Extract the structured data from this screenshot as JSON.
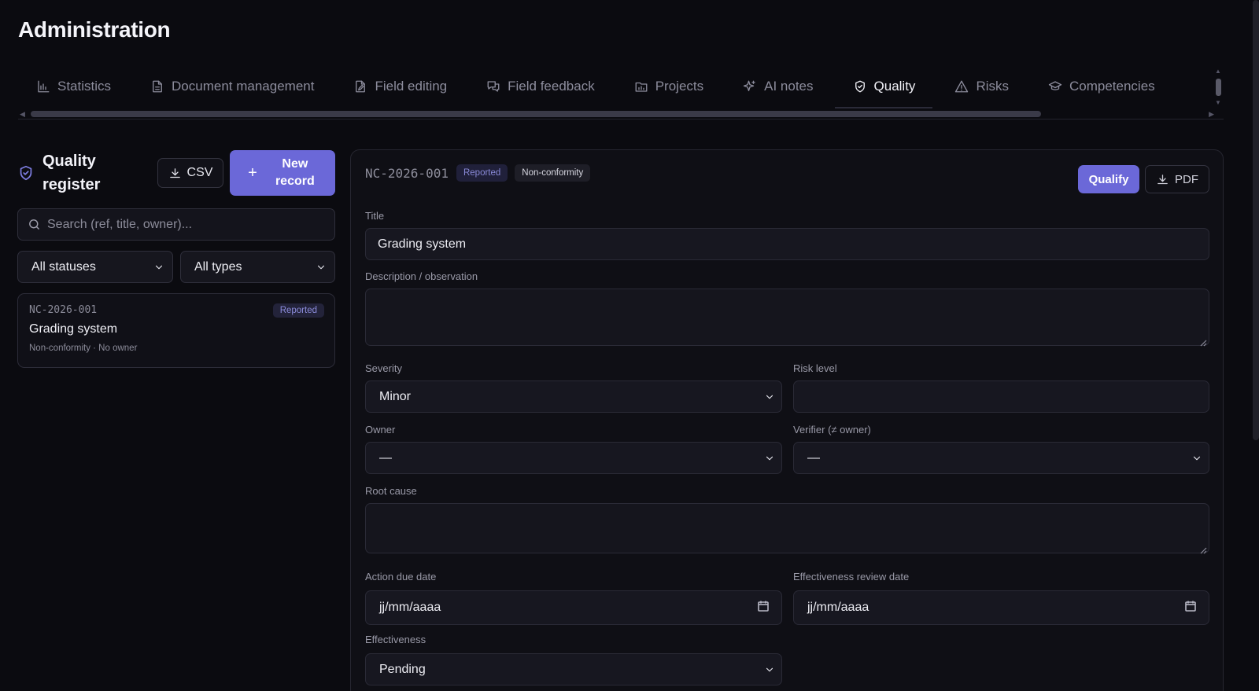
{
  "page": {
    "title": "Administration"
  },
  "tabs": [
    {
      "label": "Statistics",
      "icon": "bar-chart-icon"
    },
    {
      "label": "Document management",
      "icon": "document-icon"
    },
    {
      "label": "Field editing",
      "icon": "file-edit-icon"
    },
    {
      "label": "Field feedback",
      "icon": "chat-icon"
    },
    {
      "label": "Projects",
      "icon": "folder-chart-icon"
    },
    {
      "label": "AI notes",
      "icon": "sparkles-icon"
    },
    {
      "label": "Quality",
      "icon": "shield-check-icon",
      "active": true
    },
    {
      "label": "Risks",
      "icon": "warning-icon"
    },
    {
      "label": "Competencies",
      "icon": "graduation-cap-icon"
    }
  ],
  "register": {
    "title": "Quality register",
    "csv_label": "CSV",
    "new_label": "New record",
    "search_placeholder": "Search (ref, title, owner)...",
    "status_filter": "All statuses",
    "type_filter": "All types",
    "items": [
      {
        "ref": "NC-2026-001",
        "status": "Reported",
        "title": "Grading system",
        "meta": "Non-conformity  · No owner"
      }
    ]
  },
  "detail": {
    "ref": "NC-2026-001",
    "status": "Reported",
    "type": "Non-conformity",
    "qualify_label": "Qualify",
    "pdf_label": "PDF",
    "title_label": "Title",
    "title_value": "Grading system",
    "description_label": "Description / observation",
    "description_value": "",
    "severity_label": "Severity",
    "severity_value": "Minor",
    "risk_label": "Risk level",
    "risk_value": "",
    "owner_label": "Owner",
    "owner_value": "—",
    "verifier_label": "Verifier (≠ owner)",
    "verifier_value": "—",
    "root_cause_label": "Root cause",
    "root_cause_value": "",
    "action_due_label": "Action due date",
    "action_due_value": "jj/mm/aaaa",
    "review_date_label": "Effectiveness review date",
    "review_date_value": "jj/mm/aaaa",
    "effectiveness_label": "Effectiveness",
    "effectiveness_value": "Pending"
  },
  "colors": {
    "accent": "#6b68d8",
    "background": "#0b0b10",
    "badge_text": "#8c8cdc"
  }
}
